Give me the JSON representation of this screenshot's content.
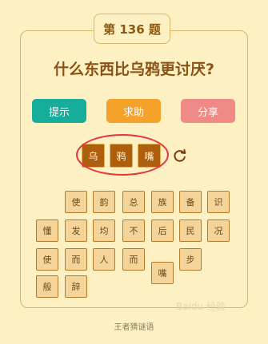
{
  "header": {
    "title": "第 136 题"
  },
  "question": "什么东西比乌鸦更讨厌?",
  "buttons": {
    "hint": "提示",
    "help": "求助",
    "share": "分享"
  },
  "answer": [
    "乌",
    "鸦",
    "嘴"
  ],
  "refresh_icon": "refresh-icon",
  "highlight_color": "#e8343d",
  "tiles": {
    "row1": [
      "使",
      "韵",
      "总",
      "族",
      "备",
      "识"
    ],
    "row2": [
      "懂",
      "发",
      "均",
      "不",
      "后",
      "民",
      "况"
    ],
    "row3": [
      "使",
      "而",
      "人",
      "而",
      "",
      "步"
    ],
    "extra": "嘴",
    "row4": [
      "般",
      "辞"
    ]
  },
  "footer": "王者猜谜语",
  "watermark": "Baidu 经验"
}
